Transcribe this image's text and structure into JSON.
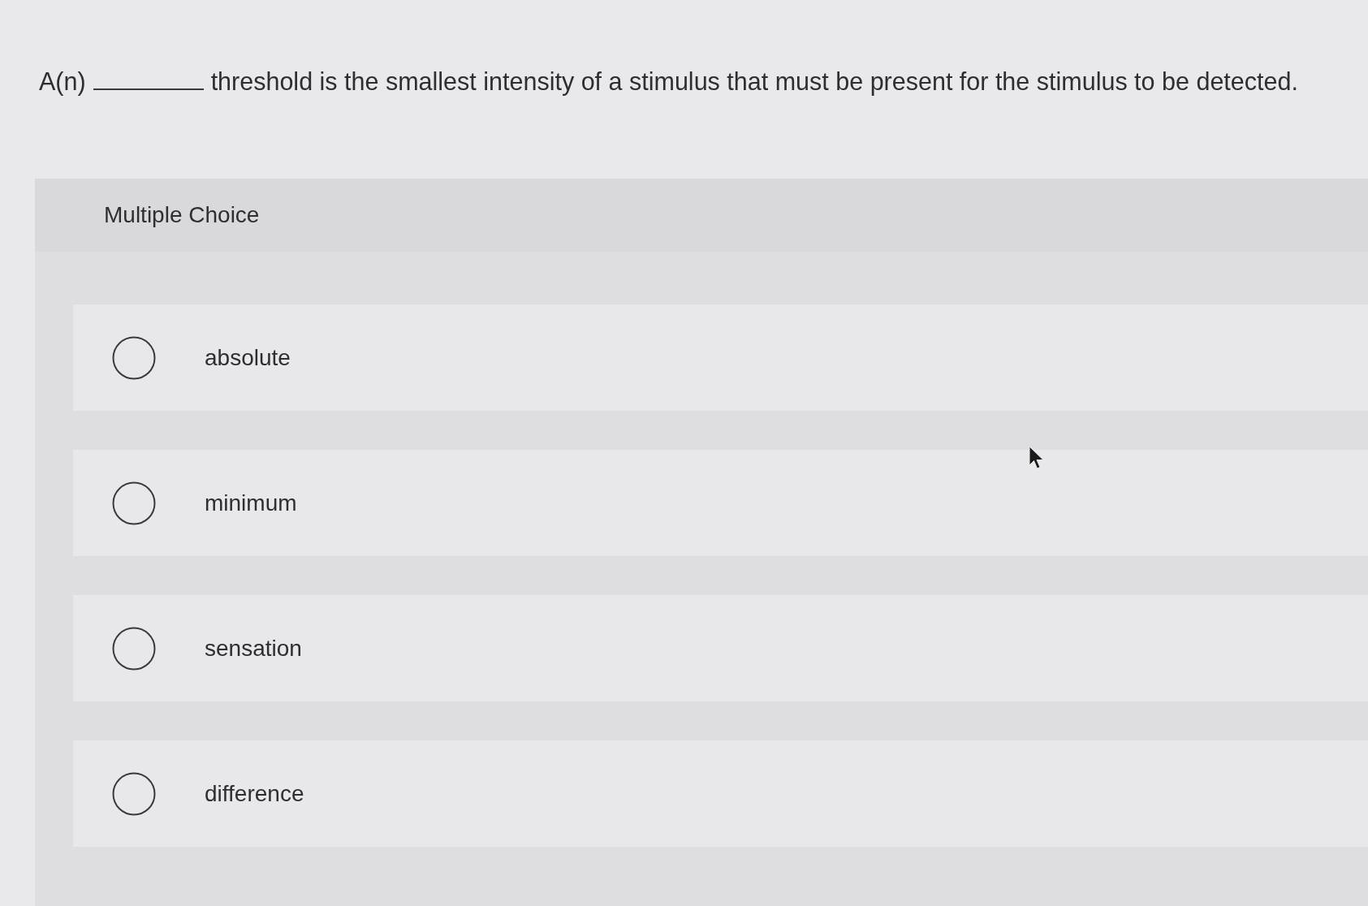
{
  "question": {
    "before_blank": "A(n)",
    "after_blank": "threshold is the smallest intensity of a stimulus that must be present for the stimulus to be detected."
  },
  "multiple_choice": {
    "heading": "Multiple Choice",
    "options": [
      {
        "label": "absolute",
        "selected": false
      },
      {
        "label": "minimum",
        "selected": false
      },
      {
        "label": "sensation",
        "selected": false
      },
      {
        "label": "difference",
        "selected": false
      }
    ]
  }
}
